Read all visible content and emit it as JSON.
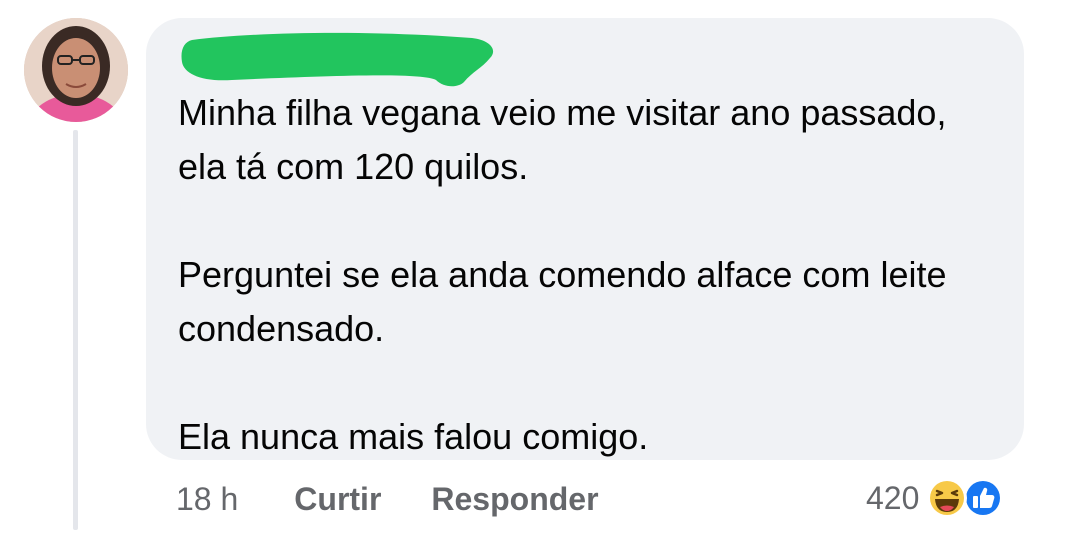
{
  "comment": {
    "author_name": "",
    "paragraphs": [
      "Minha filha vegana veio me visitar ano passado, ela tá com 120 quilos.",
      "Perguntei se ela anda comendo alface com leite condensado.",
      "Ela nunca mais falou comigo."
    ],
    "redaction_color": "#22c55e",
    "bubble_color": "#f0f2f5"
  },
  "actions": {
    "time": "18 h",
    "like_label": "Curtir",
    "reply_label": "Responder"
  },
  "reactions": {
    "count": "420",
    "icons": [
      "haha-icon",
      "like-icon"
    ]
  }
}
